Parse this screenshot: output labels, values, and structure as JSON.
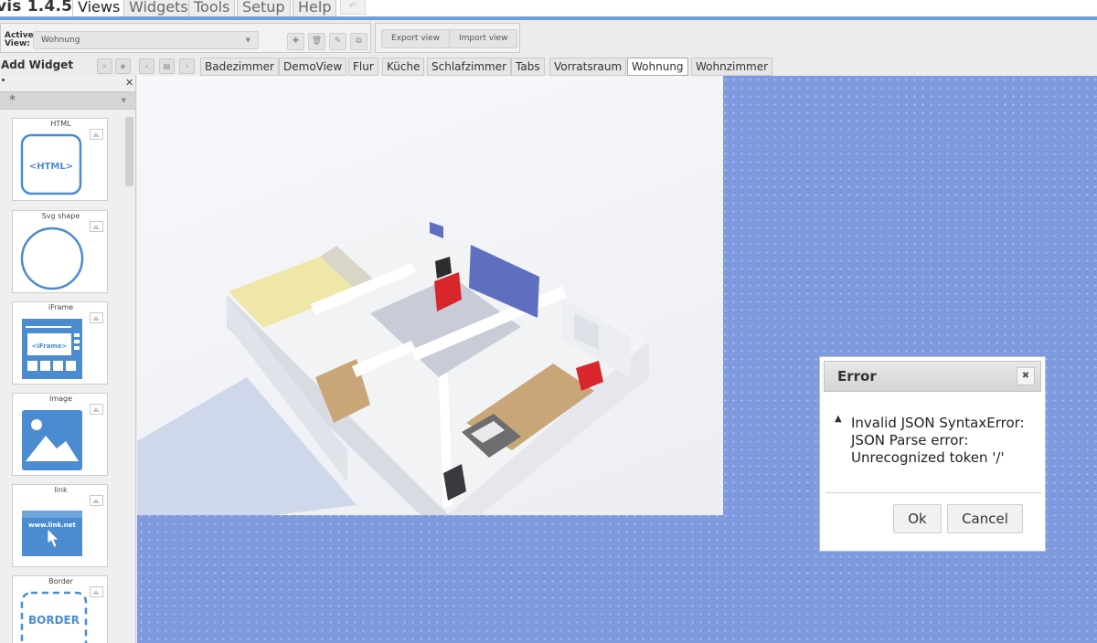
{
  "app": {
    "title": "vis 1.4.5",
    "menu": [
      {
        "label": "Views",
        "active": true
      },
      {
        "label": "Widgets",
        "active": false
      },
      {
        "label": "Tools",
        "active": false
      },
      {
        "label": "Setup",
        "active": false
      },
      {
        "label": "Help",
        "active": false
      }
    ],
    "undo_icon": "undo-icon",
    "accent_color": "#6f9fd8"
  },
  "toolbar": {
    "active_view_label": "Active View:",
    "active_view_value": "Wohnung",
    "icon_buttons": [
      "plus-icon",
      "trash-icon",
      "pencil-icon",
      "copy-icon"
    ],
    "export_label": "Export view",
    "import_label": "Import view"
  },
  "sidebar": {
    "title": "Add Widget",
    "filter_value": "*",
    "widgets": [
      {
        "label": "HTML",
        "preview_text": "<HTML>"
      },
      {
        "label": "Svg shape",
        "preview_text": ""
      },
      {
        "label": "iFrame",
        "preview_text": "<iFrame>"
      },
      {
        "label": "Image",
        "preview_text": ""
      },
      {
        "label": "link",
        "preview_text": "www.link.net"
      },
      {
        "label": "Border",
        "preview_text": "BORDER"
      }
    ]
  },
  "views": {
    "tabs": [
      "Badezimmer",
      "DemoView",
      "Flur",
      "Küche",
      "Schlafzimmer",
      "Tabs",
      "Vorratsraum",
      "Wohnung",
      "Wohnzimmer"
    ],
    "selected": "Wohnung"
  },
  "canvas": {
    "background_color": "#7e9be0"
  },
  "dialog": {
    "title": "Error",
    "message": "Invalid JSON SyntaxError: JSON Parse error: Unrecognized token '/'",
    "ok_label": "Ok",
    "cancel_label": "Cancel"
  }
}
